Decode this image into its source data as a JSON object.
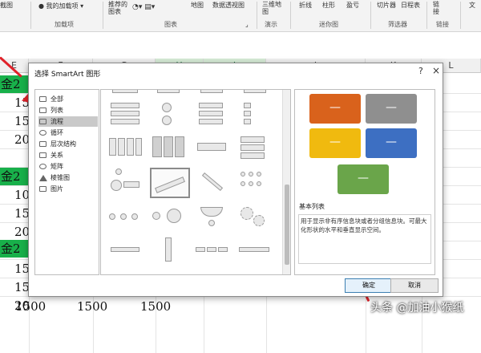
{
  "ribbon": {
    "buttons": [
      "截图",
      "我的加载项",
      "推荐的\n图表",
      "地图",
      "数据透视图",
      "三维地\n图",
      "折线",
      "柱形",
      "盈亏",
      "切片器",
      "日程表",
      "链\n接",
      "文"
    ],
    "groups": [
      "加载项",
      "图表",
      "演示",
      "迷你图",
      "筛选器",
      "链接"
    ]
  },
  "sheet": {
    "columns": [
      "E",
      "F",
      "G",
      "H",
      "I",
      "J",
      "K",
      "L"
    ],
    "rows": [
      {
        "a": "金2",
        "green": true
      },
      {
        "a": "15"
      },
      {
        "a": "15"
      },
      {
        "a": "20"
      },
      {
        "a": "金2",
        "green": true
      },
      {
        "a": "10"
      },
      {
        "a": "15"
      },
      {
        "a": "20"
      },
      {
        "a": "金2",
        "green": true
      },
      {
        "a": "15"
      },
      {
        "a": "15"
      },
      {
        "a": "20"
      }
    ],
    "last_row": [
      "1500",
      "1500",
      "1500"
    ]
  },
  "dialog": {
    "title": "选择 SmartArt 图形",
    "help": "?",
    "close": "×",
    "categories": [
      {
        "label": "全部",
        "icon": "all-icon"
      },
      {
        "label": "列表",
        "icon": "list-icon"
      },
      {
        "label": "流程",
        "icon": "process-icon",
        "selected": true
      },
      {
        "label": "循环",
        "icon": "cycle-icon"
      },
      {
        "label": "层次结构",
        "icon": "hierarchy-icon"
      },
      {
        "label": "关系",
        "icon": "relationship-icon"
      },
      {
        "label": "矩阵",
        "icon": "matrix-icon"
      },
      {
        "label": "棱锥图",
        "icon": "pyramid-icon"
      },
      {
        "label": "图片",
        "icon": "picture-icon"
      }
    ],
    "preview": {
      "boxes": [
        {
          "color": "#d9621c",
          "dash": "—"
        },
        {
          "color": "#8f8f8f",
          "dash": "—"
        },
        {
          "color": "#f0ba0f",
          "dash": "—"
        },
        {
          "color": "#3d6fc2",
          "dash": "—"
        },
        {
          "color": "#6aa54a",
          "dash": "—"
        }
      ],
      "name": "基本列表",
      "description": "用于显示非有序信息块或者分组信息块。可最大化形状的水平和垂直显示空间。"
    },
    "ok_label": "确定",
    "cancel_label": "取消"
  },
  "watermark": "头条 @加油小猴纸",
  "colors": {
    "accent_green": "#18b04a",
    "arrow_red": "#e0222a"
  }
}
